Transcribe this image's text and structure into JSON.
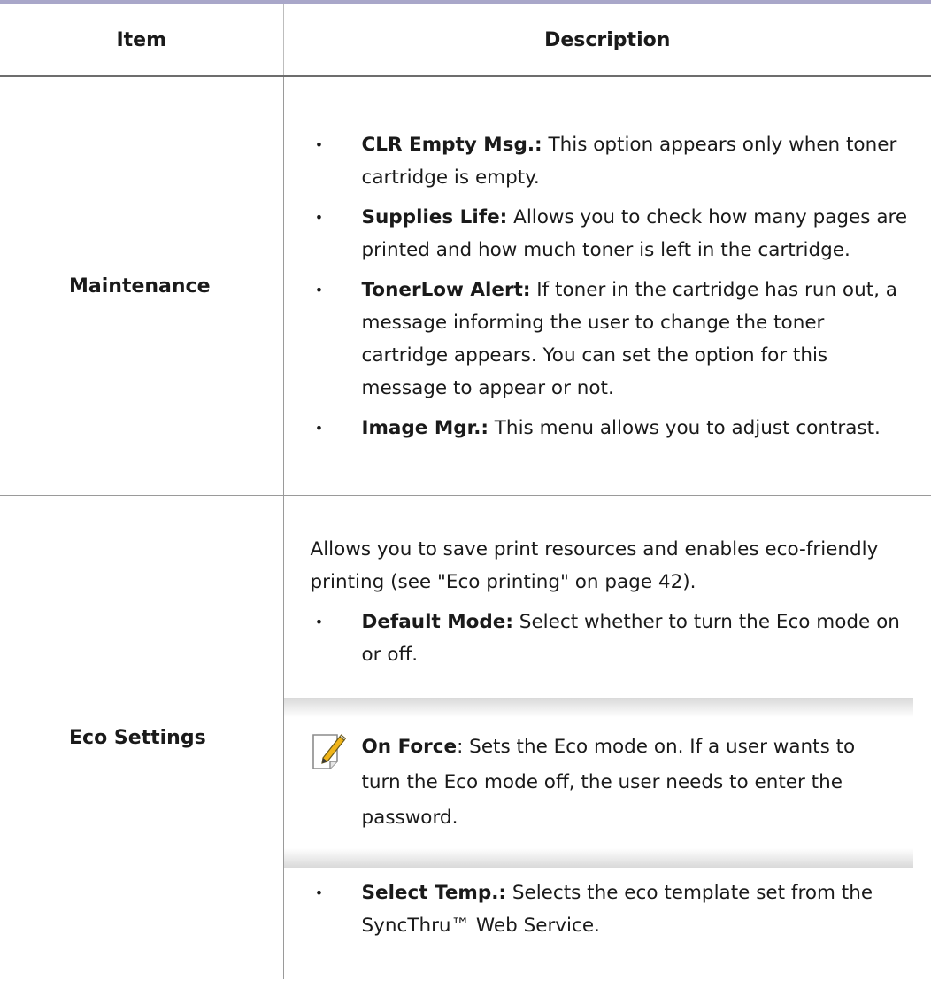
{
  "table": {
    "headers": {
      "item": "Item",
      "description": "Description"
    },
    "rows": [
      {
        "item": "Maintenance",
        "bullets": [
          {
            "term": "CLR Empty Msg.:",
            "text": "  This option appears only when toner cartridge is empty."
          },
          {
            "term": "Supplies Life:",
            "text": " Allows you to check how many pages are printed and how much toner is left in the cartridge."
          },
          {
            "term": "TonerLow Alert:",
            "text": " If toner in the cartridge has run out, a message informing the user to change the toner cartridge appears. You can set the option for this message to appear or not."
          },
          {
            "term": "Image Mgr.:",
            "text": " This menu allows you to adjust contrast."
          }
        ]
      },
      {
        "item": "Eco Settings",
        "intro": "Allows you to save print resources and enables eco-friendly printing (see \"Eco printing\" on page 42).",
        "bullets_before_note": [
          {
            "term": "Default Mode:",
            "text": " Select whether to turn the Eco mode on or off."
          }
        ],
        "note": {
          "icon": "note-pencil-icon",
          "term": "On Force",
          "text": ": Sets the Eco mode on. If a user wants to turn the Eco mode off, the user needs to enter the password."
        },
        "bullets_after_note": [
          {
            "term": "Select Temp.:",
            "text": " Selects the eco template set from the SyncThru™ Web Service."
          }
        ]
      }
    ]
  },
  "colors": {
    "top_rule": "#a9a7c9",
    "note_gradient": "#d9d9d9"
  }
}
